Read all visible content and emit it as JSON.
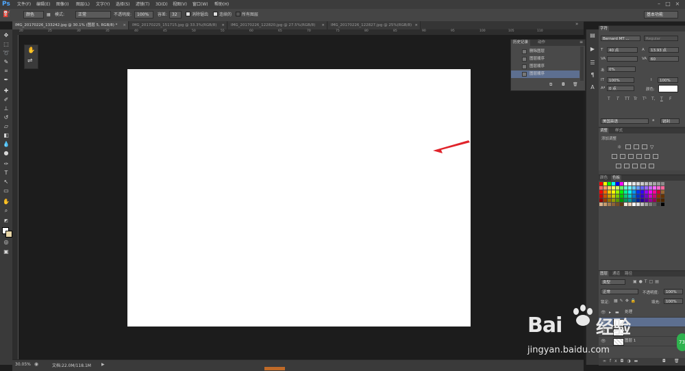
{
  "menubar": {
    "logo": "Ps",
    "items": [
      "文件(F)",
      "编辑(E)",
      "图像(I)",
      "图层(L)",
      "文字(Y)",
      "选择(S)",
      "滤镜(T)",
      "3D(D)",
      "视图(V)",
      "窗口(W)",
      "帮助(H)"
    ],
    "window_buttons": [
      "–",
      "□",
      "×"
    ]
  },
  "options_bar": {
    "brush_mode_value": "颜色",
    "mode_label": "模式:",
    "mode_value": "正常",
    "opacity_label": "不透明度:",
    "opacity_value": "100%",
    "tolerance_label": "容差:",
    "tolerance_value": "32",
    "antialias_label": "消除锯齿",
    "contiguous_label": "连续的",
    "all_layers_label": "所有图层",
    "workspace_value": "基本功能"
  },
  "doc_tabs": [
    {
      "label": "IMG_20170226_133242.jpg @ 30.1% (图层 5, RGB/8) *",
      "close": "×"
    },
    {
      "label": "IMG_20170225_151715.jpg @ 33.3%(RGB/8)",
      "close": "×"
    },
    {
      "label": "IMG_20170226_122820.jpg @ 27.5%(RGB/8)",
      "close": "×"
    },
    {
      "label": "IMG_20170226_122827.jpg @ 25%(RGB/8)",
      "close": "×"
    }
  ],
  "ruler_ticks": [
    "20",
    "25",
    "30",
    "35",
    "40",
    "45",
    "50",
    "55",
    "60",
    "65",
    "70",
    "75",
    "80",
    "85",
    "90",
    "95",
    "100",
    "105",
    "110"
  ],
  "history_panel": {
    "tabs": [
      "历史记录",
      "动作"
    ],
    "items": [
      "删除图层",
      "图层顺序",
      "图层顺序",
      "图层顺序"
    ],
    "selected_index": 3
  },
  "character_panel": {
    "tab": "字符",
    "font_family": "Bernard MT ...",
    "font_style": "Regular",
    "font_size": "40 点",
    "leading": "13.93 点",
    "kerning": "",
    "tracking": "60",
    "scale_percent": "0%",
    "vertical_scale": "100%",
    "horizontal_scale": "100%",
    "baseline": "0 点",
    "color_label": "颜色:",
    "text_style_buttons": [
      "T",
      "T",
      "TT",
      "Tr",
      "T¹",
      "T,",
      "T",
      "F"
    ],
    "language": "美国英语",
    "aa_prefix": "a",
    "aa_value": "锐利"
  },
  "adjustments_panel": {
    "tabs": [
      "调整",
      "样式"
    ],
    "title": "添加调整"
  },
  "swatches_panel": {
    "tabs": [
      "颜色",
      "色板"
    ],
    "colors": [
      "#ff0000",
      "#ffff00",
      "#00ff00",
      "#00ffff",
      "#0000ff",
      "#ff00ff",
      "#ffffff",
      "#f2f2f2",
      "#e6e6e6",
      "#d9d9d9",
      "#cccccc",
      "#bfbfbf",
      "#b3b3b3",
      "#a6a6a6",
      "#999999",
      "#8c8c8c",
      "#ff6666",
      "#ff9966",
      "#ffcc66",
      "#ffff66",
      "#ccff66",
      "#66ff66",
      "#66ffcc",
      "#66ffff",
      "#66ccff",
      "#6699ff",
      "#6666ff",
      "#9966ff",
      "#cc66ff",
      "#ff66ff",
      "#ff66cc",
      "#ff6699",
      "#ff0000",
      "#ff6600",
      "#ffcc00",
      "#ffff00",
      "#99ff00",
      "#00ff00",
      "#00ff99",
      "#00ffff",
      "#0099ff",
      "#0033ff",
      "#3300ff",
      "#9900ff",
      "#ff00ff",
      "#ff0099",
      "#cc0033",
      "#996633",
      "#cc0000",
      "#cc5200",
      "#cc9900",
      "#cccc00",
      "#77cc00",
      "#00cc00",
      "#00cc77",
      "#00cccc",
      "#0077cc",
      "#0033cc",
      "#3300cc",
      "#7700cc",
      "#cc00cc",
      "#cc0077",
      "#993300",
      "#663300",
      "#990000",
      "#993d00",
      "#997300",
      "#999900",
      "#599900",
      "#009900",
      "#009959",
      "#009999",
      "#005999",
      "#002699",
      "#260099",
      "#590099",
      "#990099",
      "#990059",
      "#663300",
      "#4d2600",
      "#d9b38c",
      "#c69c6d",
      "#a67c52",
      "#8c6239",
      "#754c24",
      "#603913",
      "#f2e6d9",
      "#e6ccb3",
      "#ffffff",
      "#e0e0e0",
      "#c0c0c0",
      "#a0a0a0",
      "#808080",
      "#606060",
      "#404040",
      "#000000"
    ]
  },
  "layers_panel": {
    "tabs": [
      "图层",
      "通道",
      "路径"
    ],
    "filter_label": "类型",
    "blend_mode": "正常",
    "opacity_label": "不透明度:",
    "opacity_value": "100%",
    "lock_label": "锁定:",
    "fill_label": "填充:",
    "fill_value": "100%",
    "layers": [
      {
        "name": "处理",
        "group": true
      },
      {
        "name": "",
        "selected": true
      },
      {
        "name": "",
        "selected": false
      },
      {
        "name": "图层 1",
        "selected": false
      }
    ]
  },
  "statusbar": {
    "zoom": "30.05%",
    "doc_info": "文档:22.0M/118.1M",
    "arrow": "▶"
  },
  "watermark": {
    "brand": "Bai",
    "brand_suffix": "经验",
    "url": "jingyan.baidu.com"
  },
  "badge": "73",
  "colors": {
    "accent_selected": "#5d6f90",
    "annotation_arrow": "#e0242b",
    "ps_blue": "#4fa8ff"
  }
}
